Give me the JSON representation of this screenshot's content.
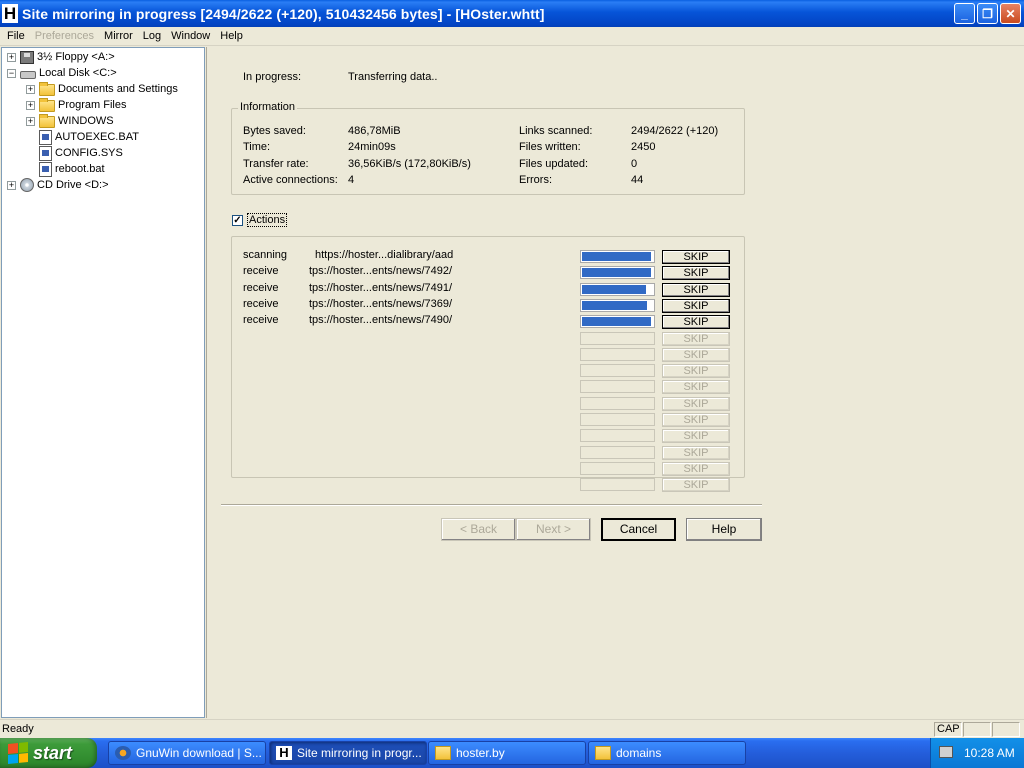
{
  "window": {
    "icon_letter": "H",
    "title": "Site mirroring in progress [2494/2622 (+120), 510432456 bytes] - [HOster.whtt]",
    "controls": [
      "minimize",
      "restore",
      "close"
    ]
  },
  "menu": [
    {
      "label": "File",
      "enabled": true
    },
    {
      "label": "Preferences",
      "enabled": false
    },
    {
      "label": "Mirror",
      "enabled": true
    },
    {
      "label": "Log",
      "enabled": true
    },
    {
      "label": "Window",
      "enabled": true
    },
    {
      "label": "Help",
      "enabled": true
    }
  ],
  "tree": [
    {
      "label": "3½ Floppy <A:>",
      "icon": "floppy-icon",
      "expander": "+",
      "depth": 0
    },
    {
      "label": "Local Disk <C:>",
      "icon": "hard-disk-icon",
      "expander": "−",
      "depth": 0
    },
    {
      "label": "Documents and Settings",
      "icon": "folder-icon",
      "expander": "+",
      "depth": 1
    },
    {
      "label": "Program Files",
      "icon": "folder-icon",
      "expander": "+",
      "depth": 1
    },
    {
      "label": "WINDOWS",
      "icon": "folder-icon",
      "expander": "+",
      "depth": 1
    },
    {
      "label": "AUTOEXEC.BAT",
      "icon": "file-icon",
      "expander": "",
      "depth": 1
    },
    {
      "label": "CONFIG.SYS",
      "icon": "file-icon",
      "expander": "",
      "depth": 1
    },
    {
      "label": "reboot.bat",
      "icon": "file-icon",
      "expander": "",
      "depth": 1
    },
    {
      "label": "CD Drive <D:>",
      "icon": "cd-drive-icon",
      "expander": "+",
      "depth": 0
    }
  ],
  "progress": {
    "label": "In progress:",
    "value": "Transferring data.."
  },
  "information": {
    "title": "Information",
    "left": [
      {
        "label": "Bytes saved:",
        "value": "486,78MiB"
      },
      {
        "label": "Time:",
        "value": "24min09s"
      },
      {
        "label": "Transfer rate:",
        "value": "36,56KiB/s (172,80KiB/s)"
      },
      {
        "label": "Active connections:",
        "value": "4"
      }
    ],
    "right": [
      {
        "label": "Links scanned:",
        "value": "2494/2622 (+120)"
      },
      {
        "label": "Files written:",
        "value": "2450"
      },
      {
        "label": "Files updated:",
        "value": "0"
      },
      {
        "label": "Errors:",
        "value": "44"
      }
    ]
  },
  "actions": {
    "checkbox_label": "Actions",
    "checked": true,
    "check_mark": "✓",
    "skip_label": "SKIP",
    "rows": [
      {
        "action": "scanning",
        "url": "https://hoster...dialibrary/aad",
        "progress": 0.97,
        "active": true
      },
      {
        "action": "receive",
        "url": "tps://hoster...ents/news/7492/",
        "progress": 0.97,
        "active": true
      },
      {
        "action": "receive",
        "url": "tps://hoster...ents/news/7491/",
        "progress": 0.9,
        "active": true
      },
      {
        "action": "receive",
        "url": "tps://hoster...ents/news/7369/",
        "progress": 0.92,
        "active": true
      },
      {
        "action": "receive",
        "url": "tps://hoster...ents/news/7490/",
        "progress": 0.97,
        "active": true
      },
      {
        "action": "",
        "url": "",
        "progress": 0,
        "active": false
      },
      {
        "action": "",
        "url": "",
        "progress": 0,
        "active": false
      },
      {
        "action": "",
        "url": "",
        "progress": 0,
        "active": false
      },
      {
        "action": "",
        "url": "",
        "progress": 0,
        "active": false
      },
      {
        "action": "",
        "url": "",
        "progress": 0,
        "active": false
      },
      {
        "action": "",
        "url": "",
        "progress": 0,
        "active": false
      },
      {
        "action": "",
        "url": "",
        "progress": 0,
        "active": false
      },
      {
        "action": "",
        "url": "",
        "progress": 0,
        "active": false
      },
      {
        "action": "",
        "url": "",
        "progress": 0,
        "active": false
      },
      {
        "action": "",
        "url": "",
        "progress": 0,
        "active": false
      }
    ]
  },
  "buttons": {
    "back": "< Back",
    "next": "Next >",
    "cancel": "Cancel",
    "help": "Help"
  },
  "status": {
    "text": "Ready",
    "cap": "CAP"
  },
  "taskbar": {
    "start_label": "start",
    "tasks": [
      {
        "label": "GnuWin download | S...",
        "icon": "browser-icon",
        "active": false
      },
      {
        "label": "Site mirroring in progr...",
        "icon": "httrack-icon",
        "active": true
      },
      {
        "label": "hoster.by",
        "icon": "folder-icon",
        "active": false
      },
      {
        "label": "domains",
        "icon": "folder-icon",
        "active": false
      }
    ],
    "clock": "10:28 AM"
  },
  "colors": {
    "progress_fill": "#316ac5",
    "titlebar": "#0654d8",
    "taskbar": "#245edb",
    "start_green": "#3d9b3a"
  }
}
